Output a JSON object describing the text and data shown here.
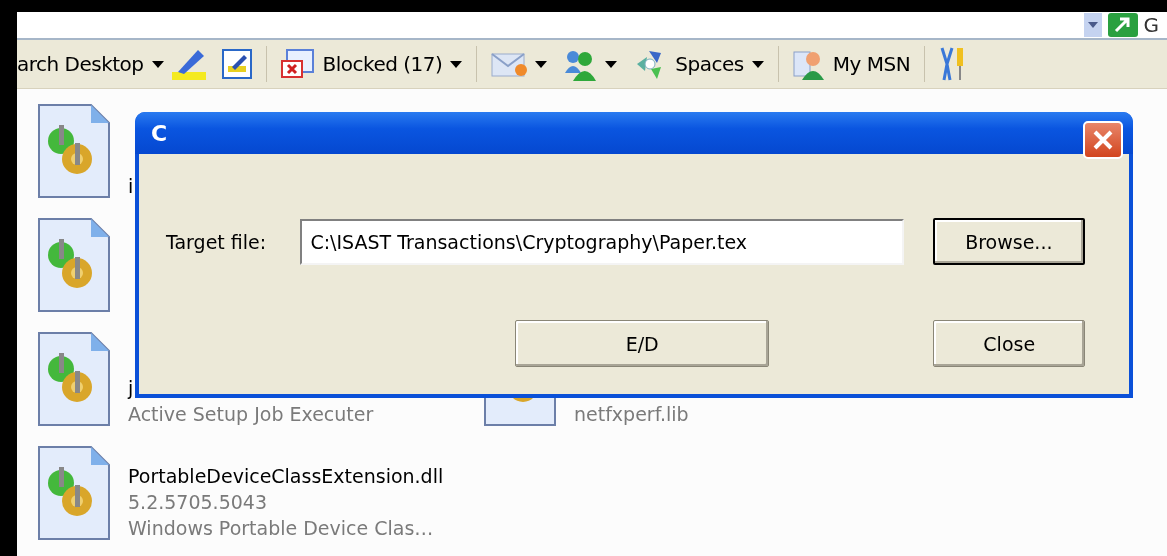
{
  "address_bar": {
    "go_label": "G"
  },
  "toolbar": {
    "items": [
      {
        "kind": "search",
        "label": "arch Desktop",
        "dropdown": true
      },
      {
        "kind": "highlight",
        "dropdown": false
      },
      {
        "kind": "edit",
        "dropdown": false,
        "separator_after": true
      },
      {
        "kind": "blocked",
        "label": "Blocked (17)",
        "dropdown": true,
        "separator_after": true
      },
      {
        "kind": "mail",
        "dropdown": true
      },
      {
        "kind": "messenger",
        "dropdown": true
      },
      {
        "kind": "spaces",
        "label": "Spaces",
        "dropdown": true,
        "separator_after": true
      },
      {
        "kind": "mymsn",
        "label": "My MSN",
        "dropdown": false,
        "separator_after": true
      },
      {
        "kind": "tools",
        "dropdown": false
      }
    ]
  },
  "files": [
    {
      "files": [
        {
          "kind": "file",
          "name": "i"
        }
      ]
    },
    {
      "files": [
        {
          "kind": "file"
        }
      ]
    },
    {
      "files": [
        {
          "kind": "file",
          "name": "j",
          "lines": [
            "Active Setup Job Executer"
          ]
        },
        {
          "kind": "file",
          "lines": [
            "netfxperf.lib"
          ]
        }
      ]
    },
    {
      "files": [
        {
          "kind": "file",
          "name": "PortableDeviceClassExtension.dll",
          "lines": [
            "5.2.5705.5043",
            "Windows Portable Device Clas…"
          ]
        }
      ]
    }
  ],
  "dialog": {
    "title": "C",
    "field_label": "Target file:",
    "field_value": "C:\\ISAST Transactions\\Cryptography\\Paper.tex",
    "browse_label": "Browse...",
    "buttons": [
      {
        "label": "E/D",
        "default": false
      },
      {
        "label": "Close",
        "default": false
      }
    ]
  }
}
